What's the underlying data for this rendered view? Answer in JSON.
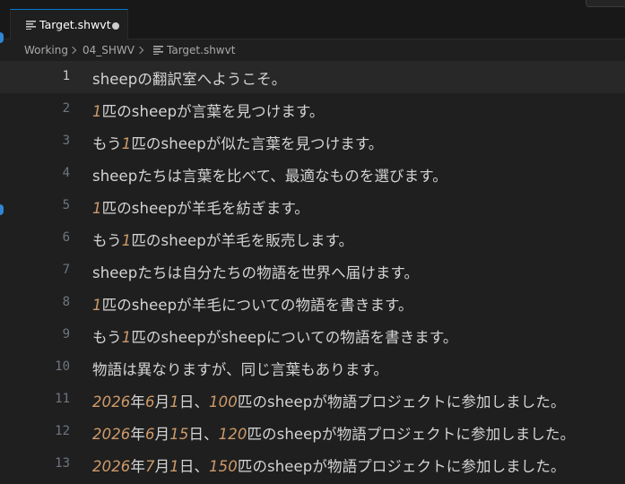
{
  "tab": {
    "filename": "Target.shwvt",
    "modified": true
  },
  "breadcrumb": {
    "items": [
      "Working",
      "04_SHWV",
      "Target.shwvt"
    ]
  },
  "editor": {
    "current_line": 1,
    "lines": [
      {
        "number": "1",
        "segments": [
          {
            "t": "sheepの翻訳室へようこそ。",
            "num": false
          }
        ]
      },
      {
        "number": "2",
        "segments": [
          {
            "t": "1",
            "num": true
          },
          {
            "t": "匹のsheepが言葉を見つけます。",
            "num": false
          }
        ]
      },
      {
        "number": "3",
        "segments": [
          {
            "t": "もう",
            "num": false
          },
          {
            "t": "1",
            "num": true
          },
          {
            "t": "匹のsheepが似た言葉を見つけます。",
            "num": false
          }
        ]
      },
      {
        "number": "4",
        "segments": [
          {
            "t": "sheepたちは言葉を比べて、最適なものを選びます。",
            "num": false
          }
        ]
      },
      {
        "number": "5",
        "segments": [
          {
            "t": "1",
            "num": true
          },
          {
            "t": "匹のsheepが羊毛を紡ぎます。",
            "num": false
          }
        ]
      },
      {
        "number": "6",
        "segments": [
          {
            "t": "もう",
            "num": false
          },
          {
            "t": "1",
            "num": true
          },
          {
            "t": "匹のsheepが羊毛を販売します。",
            "num": false
          }
        ]
      },
      {
        "number": "7",
        "segments": [
          {
            "t": "sheepたちは自分たちの物語を世界へ届けます。",
            "num": false
          }
        ]
      },
      {
        "number": "8",
        "segments": [
          {
            "t": "1",
            "num": true
          },
          {
            "t": "匹のsheepが羊毛についての物語を書きます。",
            "num": false
          }
        ]
      },
      {
        "number": "9",
        "segments": [
          {
            "t": "もう",
            "num": false
          },
          {
            "t": "1",
            "num": true
          },
          {
            "t": "匹のsheepがsheepについての物語を書きます。",
            "num": false
          }
        ]
      },
      {
        "number": "10",
        "segments": [
          {
            "t": "物語は異なりますが、同じ言葉もあります。",
            "num": false
          }
        ]
      },
      {
        "number": "11",
        "segments": [
          {
            "t": "2026",
            "num": true
          },
          {
            "t": "年",
            "num": false
          },
          {
            "t": "6",
            "num": true
          },
          {
            "t": "月",
            "num": false
          },
          {
            "t": "1",
            "num": true
          },
          {
            "t": "日、",
            "num": false
          },
          {
            "t": "100",
            "num": true
          },
          {
            "t": "匹のsheepが物語プロジェクトに参加しました。",
            "num": false
          }
        ]
      },
      {
        "number": "12",
        "segments": [
          {
            "t": "2026",
            "num": true
          },
          {
            "t": "年",
            "num": false
          },
          {
            "t": "6",
            "num": true
          },
          {
            "t": "月",
            "num": false
          },
          {
            "t": "15",
            "num": true
          },
          {
            "t": "日、",
            "num": false
          },
          {
            "t": "120",
            "num": true
          },
          {
            "t": "匹のsheepが物語プロジェクトに参加しました。",
            "num": false
          }
        ]
      },
      {
        "number": "13",
        "segments": [
          {
            "t": "2026",
            "num": true
          },
          {
            "t": "年",
            "num": false
          },
          {
            "t": "7",
            "num": true
          },
          {
            "t": "月",
            "num": false
          },
          {
            "t": "1",
            "num": true
          },
          {
            "t": "日、",
            "num": false
          },
          {
            "t": "150",
            "num": true
          },
          {
            "t": "匹のsheepが物語プロジェクトに参加しました。",
            "num": false
          }
        ]
      }
    ]
  },
  "colors": {
    "background": "#1f1f1f",
    "text": "#d4d4d4",
    "number_literal": "#ce9a6a",
    "line_number": "#6e7681",
    "accent": "#0078d4"
  },
  "icons": {
    "file_type": "file-lines-icon",
    "dirty": "unsaved-dot-icon",
    "separator": "chevron-right-icon"
  }
}
